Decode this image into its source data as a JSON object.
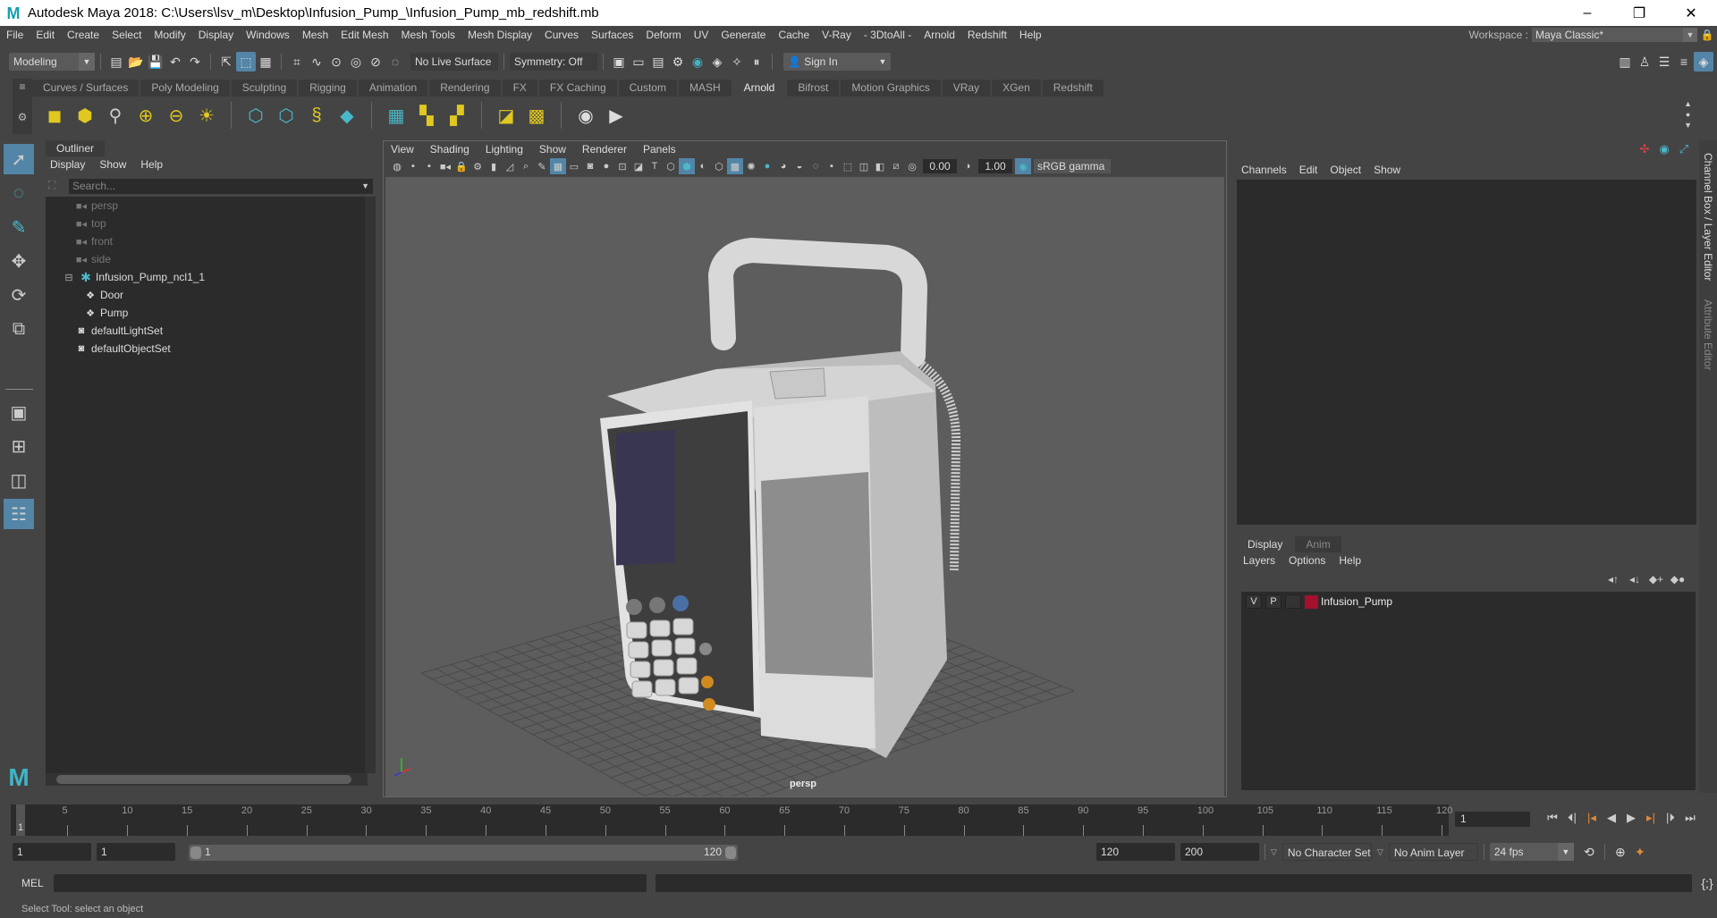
{
  "window": {
    "title": "Autodesk Maya 2018: C:\\Users\\lsv_m\\Desktop\\Infusion_Pump_\\Infusion_Pump_mb_redshift.mb",
    "minimize": "–",
    "maximize": "❐",
    "close": "✕"
  },
  "menubar": {
    "items": [
      "File",
      "Edit",
      "Create",
      "Select",
      "Modify",
      "Display",
      "Windows",
      "Mesh",
      "Edit Mesh",
      "Mesh Tools",
      "Mesh Display",
      "Curves",
      "Surfaces",
      "Deform",
      "UV",
      "Generate",
      "Cache",
      "V-Ray",
      "- 3DtoAll -",
      "Arnold",
      "Redshift",
      "Help"
    ],
    "workspace_label": "Workspace :",
    "workspace_value": "Maya Classic*"
  },
  "statusline": {
    "mode": "Modeling",
    "live_surface": "No Live Surface",
    "symmetry": "Symmetry: Off",
    "sign_in": "Sign In"
  },
  "shelf": {
    "tabs": [
      "Curves / Surfaces",
      "Poly Modeling",
      "Sculpting",
      "Rigging",
      "Animation",
      "Rendering",
      "FX",
      "FX Caching",
      "Custom",
      "MASH",
      "Arnold",
      "Bifrost",
      "Motion Graphics",
      "VRay",
      "XGen",
      "Redshift"
    ],
    "active_tab": "Arnold"
  },
  "outliner": {
    "tab": "Outliner",
    "menus": [
      "Display",
      "Show",
      "Help"
    ],
    "search_placeholder": "Search...",
    "items": [
      {
        "label": "persp",
        "type": "camera",
        "indent": 0,
        "dim": true
      },
      {
        "label": "top",
        "type": "camera",
        "indent": 0,
        "dim": true
      },
      {
        "label": "front",
        "type": "camera",
        "indent": 0,
        "dim": true
      },
      {
        "label": "side",
        "type": "camera",
        "indent": 0,
        "dim": true
      },
      {
        "label": "Infusion_Pump_ncl1_1",
        "type": "group",
        "indent": 0,
        "expanded": true
      },
      {
        "label": "Door",
        "type": "mesh",
        "indent": 1
      },
      {
        "label": "Pump",
        "type": "mesh",
        "indent": 1
      },
      {
        "label": "defaultLightSet",
        "type": "set",
        "indent": 0
      },
      {
        "label": "defaultObjectSet",
        "type": "set",
        "indent": 0
      }
    ]
  },
  "viewport": {
    "menus": [
      "View",
      "Shading",
      "Lighting",
      "Show",
      "Renderer",
      "Panels"
    ],
    "exposure": "0.00",
    "gamma": "1.00",
    "color_space": "sRGB gamma",
    "camera_label": "persp"
  },
  "channelbox": {
    "menus": [
      "Channels",
      "Edit",
      "Object",
      "Show"
    ],
    "side_tab_1": "Channel Box / Layer Editor",
    "side_tab_2": "Attribute Editor"
  },
  "layers": {
    "tabs": [
      "Display",
      "Anim"
    ],
    "active_tab": "Display",
    "menus": [
      "Layers",
      "Options",
      "Help"
    ],
    "rows": [
      {
        "v": "V",
        "p": "P",
        "name": "Infusion_Pump",
        "color": "#a5102e"
      }
    ]
  },
  "timeline": {
    "ticks": [
      5,
      10,
      15,
      20,
      25,
      30,
      35,
      40,
      45,
      50,
      55,
      60,
      65,
      70,
      75,
      80,
      85,
      90,
      95,
      100,
      105,
      110,
      115,
      120
    ],
    "min": 1,
    "max": 120,
    "current_frame": "1",
    "current_frame_field": "1"
  },
  "range": {
    "start_time": "1",
    "playback_start": "1",
    "range_start_label": "1",
    "range_end_label": "120",
    "playback_end": "120",
    "end_time": "200",
    "character_set": "No Character Set",
    "anim_layer": "No Anim Layer",
    "fps": "24 fps"
  },
  "command_line": {
    "label": "MEL"
  },
  "help_line": {
    "text": "Select Tool: select an object"
  }
}
